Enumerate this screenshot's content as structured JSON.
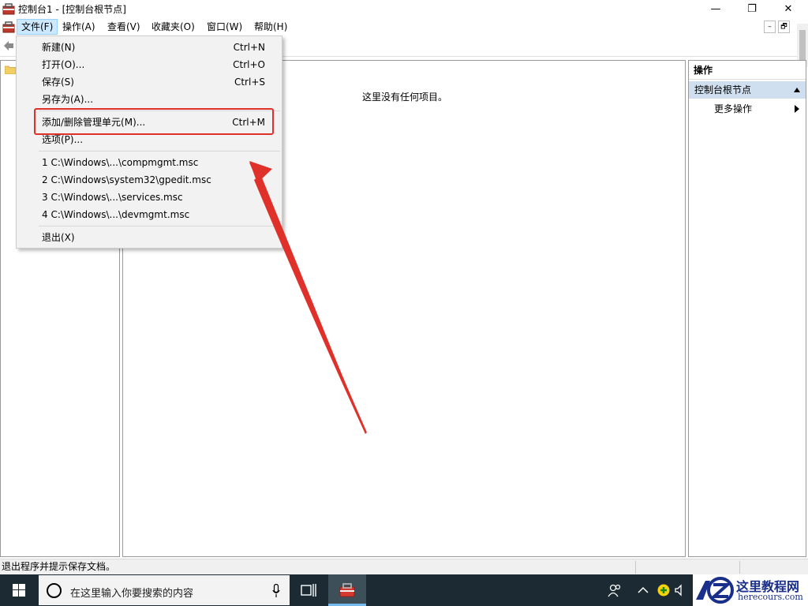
{
  "window": {
    "title": "控制台1 - [控制台根节点]",
    "icon": "mmc-toolbox-icon",
    "minimize_glyph": "—",
    "restore_glyph": "❐",
    "close_glyph": "✕"
  },
  "menubar": {
    "items": [
      {
        "label": "文件(F)",
        "active": true
      },
      {
        "label": "操作(A)"
      },
      {
        "label": "查看(V)"
      },
      {
        "label": "收藏夹(O)"
      },
      {
        "label": "窗口(W)"
      },
      {
        "label": "帮助(H)"
      }
    ],
    "mdi_buttons": [
      "–",
      "🗗",
      "✕"
    ]
  },
  "file_menu": {
    "items": [
      {
        "label": "新建(N)",
        "shortcut": "Ctrl+N"
      },
      {
        "label": "打开(O)...",
        "shortcut": "Ctrl+O"
      },
      {
        "label": "保存(S)",
        "shortcut": "Ctrl+S"
      },
      {
        "label": "另存为(A)..."
      },
      {
        "label": "添加/删除管理单元(M)...",
        "shortcut": "Ctrl+M",
        "highlighted": true
      },
      {
        "label": "选项(P)..."
      },
      {
        "label": "1 C:\\Windows\\...\\compmgmt.msc"
      },
      {
        "label": "2 C:\\Windows\\system32\\gpedit.msc"
      },
      {
        "label": "3 C:\\Windows\\...\\services.msc"
      },
      {
        "label": "4 C:\\Windows\\...\\devmgmt.msc"
      },
      {
        "label": "退出(X)"
      }
    ]
  },
  "center_pane": {
    "empty_message": "这里没有任何项目。"
  },
  "actions_pane": {
    "header": "操作",
    "node": "控制台根节点",
    "more": "更多操作"
  },
  "statusbar": {
    "text": "退出程序并提示保存文档。"
  },
  "taskbar": {
    "search_placeholder": "在这里输入你要搜索的内容",
    "icons": [
      "windows-start-icon",
      "cortana-circle-icon",
      "microphone-icon",
      "task-view-icon",
      "mmc-app-icon",
      "people-icon",
      "chevron-up-icon",
      "shield-update-icon",
      "speaker-icon"
    ]
  },
  "watermark": {
    "text": "这里教程网",
    "url": "herecours.com"
  },
  "colors": {
    "highlight_red": "#e0302a",
    "menu_active": "#cce8ff",
    "actions_node_bg": "#cfdfef",
    "taskbar_bg": "#1c2b33"
  }
}
